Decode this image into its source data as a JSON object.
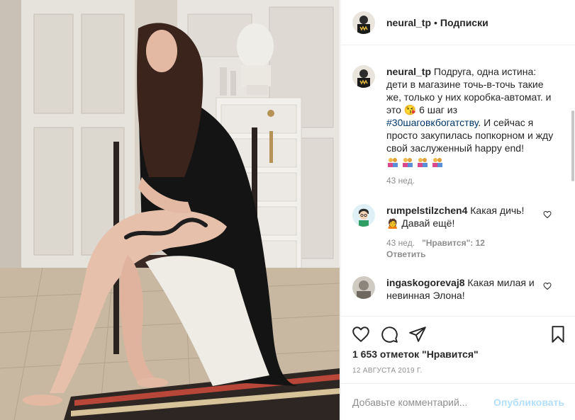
{
  "header": {
    "username": "neural_tp",
    "separator": "•",
    "follow_label": "Подписки"
  },
  "caption": {
    "username": "neural_tp",
    "text_before": "Подруга, одна истина: дети в магазине точь-в-точь такие же, только у них коробка-автомат. и это",
    "emoji": "face-kiss-emoji",
    "text_mid": "6 шаг из",
    "hashtag": "#30шаговкбогатству",
    "text_after": ". И сейчас я просто закупилась попкорном и жду свой заслуженный happy end!",
    "emoji_row": [
      "people-emoji",
      "people-emoji",
      "people-emoji",
      "people-emoji"
    ],
    "age": "43 нед."
  },
  "comments": [
    {
      "username": "rumpelstilzchen4",
      "text": "Какая дичь!",
      "text2": "Давай ещё!",
      "emoji": "woman-emoji",
      "age": "43 нед.",
      "likes": "\"Нравится\": 12",
      "reply_label": "Ответить"
    },
    {
      "username": "ingaskogorevaj8",
      "text": "Какая милая и невинная Элона!"
    }
  ],
  "likes_text": "1 653 отметок \"Нравится\"",
  "date": "12 АВГУСТА 2019 Г.",
  "add_comment": {
    "placeholder": "Добавьте комментарий...",
    "post_label": "Опубликовать"
  },
  "colors": {
    "link": "#00376b",
    "muted": "#8e8e8e",
    "post_disabled": "#b2dffc"
  }
}
